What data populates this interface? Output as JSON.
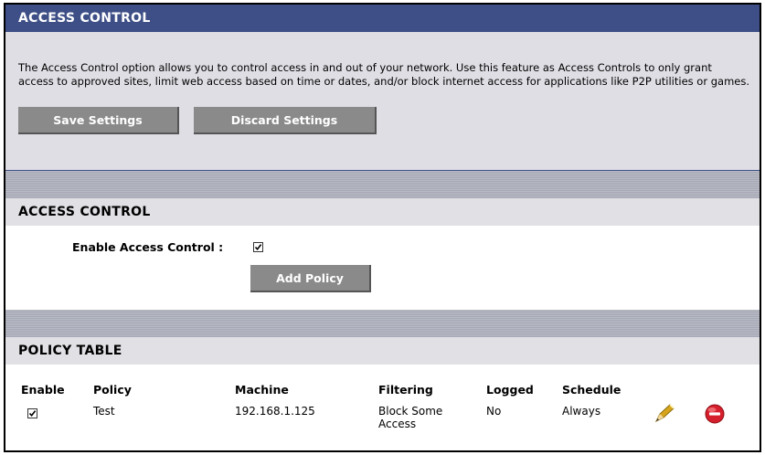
{
  "header": {
    "title": "ACCESS CONTROL"
  },
  "intro": {
    "text": "The Access Control option allows you to control access in and out of your network. Use this feature as Access Controls to only grant access to approved sites, limit web access based on time or dates, and/or block internet access for applications like P2P utilities or games.",
    "save_label": "Save Settings",
    "discard_label": "Discard Settings"
  },
  "access_control": {
    "title": "ACCESS CONTROL",
    "enable_label": "Enable Access Control :",
    "enabled": true,
    "add_policy_label": "Add Policy"
  },
  "policy_table": {
    "title": "POLICY TABLE",
    "columns": [
      "Enable",
      "Policy",
      "Machine",
      "Filtering",
      "Logged",
      "Schedule"
    ],
    "rows": [
      {
        "enabled": true,
        "policy": "Test",
        "machine": "192.168.1.125",
        "filtering": "Block Some Access",
        "logged": "No",
        "schedule": "Always",
        "edit_icon": "pencil-icon",
        "delete_icon": "delete-icon"
      }
    ]
  },
  "colors": {
    "header_bg": "#3d4f86",
    "intro_bg": "#dfdee4",
    "button_bg": "#8a8a8a",
    "stripe_bg": "#a5a8b5",
    "delete_red": "#d61f2c",
    "pencil_gold": "#d7a51c"
  }
}
